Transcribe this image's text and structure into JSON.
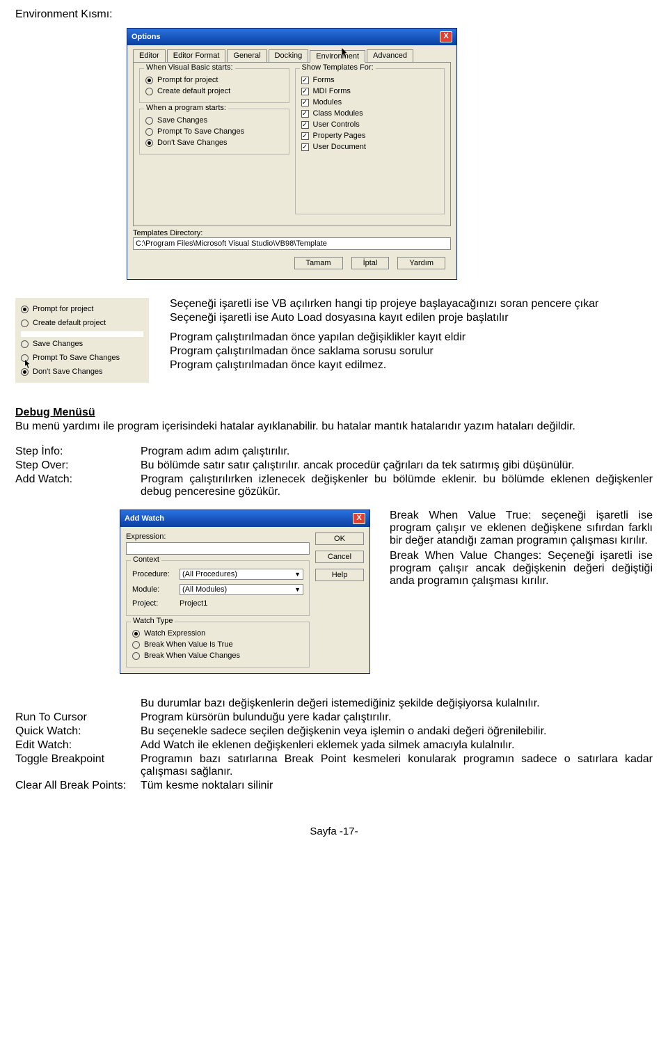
{
  "heading": "Environment Kısmı:",
  "optionsDialog": {
    "title": "Options",
    "close": "X",
    "tabs": [
      "Editor",
      "Editor Format",
      "General",
      "Docking",
      "Environment",
      "Advanced"
    ],
    "selectedTab": "Environment",
    "group1": {
      "legend": "When Visual Basic starts:",
      "radios": [
        {
          "label": "Prompt for project",
          "on": true
        },
        {
          "label": "Create default project",
          "on": false
        }
      ]
    },
    "group2": {
      "legend": "When a program starts:",
      "radios": [
        {
          "label": "Save Changes",
          "on": false
        },
        {
          "label": "Prompt To Save Changes",
          "on": false
        },
        {
          "label": "Don't Save Changes",
          "on": true
        }
      ]
    },
    "group3": {
      "legend": "Show Templates For:",
      "checks": [
        {
          "label": "Forms",
          "on": true
        },
        {
          "label": "MDI Forms",
          "on": true
        },
        {
          "label": "Modules",
          "on": true
        },
        {
          "label": "Class Modules",
          "on": true
        },
        {
          "label": "User Controls",
          "on": true
        },
        {
          "label": "Property Pages",
          "on": true
        },
        {
          "label": "User Document",
          "on": true
        }
      ]
    },
    "dirLabel": "Templates Directory:",
    "dirValue": "C:\\Program Files\\Microsoft Visual Studio\\VB98\\Template",
    "buttons": [
      "Tamam",
      "İptal",
      "Yardım"
    ]
  },
  "leftRadios": [
    {
      "label": "Prompt for project",
      "on": true
    },
    {
      "label": "Create default project",
      "on": false
    },
    {
      "label": "Save Changes",
      "on": false
    },
    {
      "label": "Prompt To Save Changes",
      "on": false
    },
    {
      "label": "Don't Save Changes",
      "on": true
    }
  ],
  "rightDescs": [
    "Seçeneği işaretli ise VB açılırken hangi tip projeye başlayacağınızı soran pencere çıkar",
    "Seçeneği işaretli ise Auto Load dosyasına kayıt edilen proje başlatılır",
    "Program çalıştırılmadan önce yapılan değişiklikler kayıt eldir",
    "Program çalıştırılmadan önce  saklama sorusu sorulur",
    "Program çalıştırılmadan önce kayıt edilmez."
  ],
  "debugHead": "Debug Menüsü",
  "debugPara": "Bu menü yardımı ile program içerisindeki hatalar ayıklanabilir. bu hatalar mantık hatalarıdır yazım hataları  değildir.",
  "stepDefs": [
    {
      "term": "Step İnfo:",
      "desc": "Program adım adım çalıştırılır."
    },
    {
      "term": "Step Over:",
      "desc": "Bu bölümde satır satır çalıştırılır. ancak procedür çağrıları da tek satırmış gibi düşünülür."
    },
    {
      "term": "Add Watch:",
      "desc": "Program çalıştırılırken izlenecek değişkenler bu bölümde eklenir. bu bölümde eklenen değişkenler debug penceresine gözükür."
    }
  ],
  "addWatch": {
    "title": "Add Watch",
    "close": "X",
    "expressionLabel": "Expression:",
    "expressionValue": "",
    "context": {
      "legend": "Context",
      "procLabel": "Procedure:",
      "procValue": "(All Procedures)",
      "modLabel": "Module:",
      "modValue": "(All Modules)",
      "projLabel": "Project:",
      "projValue": "Project1"
    },
    "watchType": {
      "legend": "Watch Type",
      "radios": [
        {
          "label": "Watch Expression",
          "on": true
        },
        {
          "label": "Break When Value Is True",
          "on": false
        },
        {
          "label": "Break When Value Changes",
          "on": false
        }
      ]
    },
    "buttons": [
      "OK",
      "Cancel",
      "Help"
    ]
  },
  "awNotes": [
    "Break When Value True: seçeneği işaretli ise program çalışır ve eklenen değişkene sıfırdan farklı bir değer atandığı zaman programın çalışması kırılır.",
    "Break When Value Changes: Seçeneği işaretli ise program çalışır ancak değişkenin değeri değiştiği anda programın çalışması kırılır."
  ],
  "belowDefs": [
    {
      "term": "",
      "desc": "Bu durumlar bazı değişkenlerin değeri istemediğiniz şekilde değişiyorsa kulalnılır."
    },
    {
      "term": "Run To Cursor",
      "desc": "Program kürsörün bulunduğu yere kadar çalıştırılır."
    },
    {
      "term": "Quick Watch:",
      "desc": "Bu seçenekle sadece seçilen değişkenin veya işlemin o andaki değeri öğrenilebilir."
    },
    {
      "term": "Edit Watch:",
      "desc": "Add Watch ile eklenen değişkenleri  eklemek yada silmek amacıyla kulalnılır."
    },
    {
      "term": "Toggle Breakpoint",
      "desc": "Programın bazı satırlarına Break Point kesmeleri konularak programın sadece o satırlara kadar çalışması sağlanır."
    },
    {
      "term": "Clear All Break Points:",
      "desc": "Tüm kesme noktaları silinir"
    }
  ],
  "pageNum": "Sayfa -17-"
}
